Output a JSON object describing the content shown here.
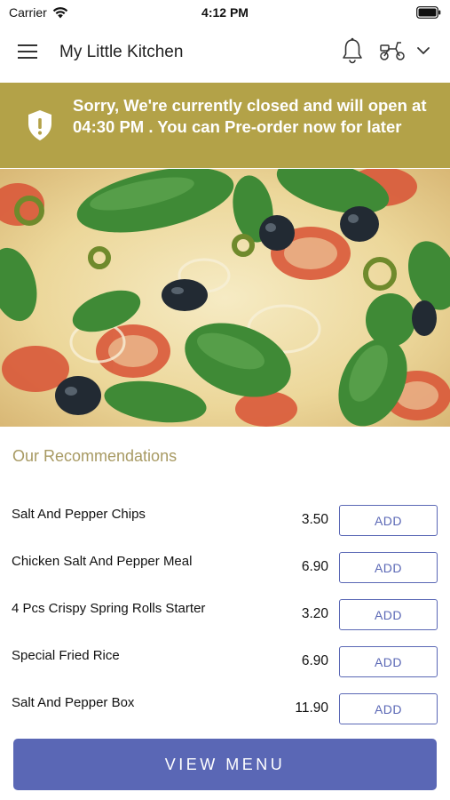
{
  "status_bar": {
    "carrier": "Carrier",
    "time": "4:12 PM"
  },
  "header": {
    "title": "My Little Kitchen",
    "icons": [
      "menu-icon",
      "bell-icon",
      "scooter-icon",
      "chevron-down-icon"
    ]
  },
  "banner": {
    "message": "Sorry, We're currently closed and will open at 04:30 PM . You can Pre-order now for later",
    "icon": "shield-exclamation-icon",
    "color": "#b3a248"
  },
  "recommendations": {
    "title": "Our Recommendations",
    "items": [
      {
        "name": "Salt And Pepper Chips",
        "price": "3.50",
        "button": "ADD"
      },
      {
        "name": "Chicken Salt And Pepper Meal",
        "price": "6.90",
        "button": "ADD"
      },
      {
        "name": "4 Pcs Crispy Spring Rolls Starter",
        "price": "3.20",
        "button": "ADD"
      },
      {
        "name": "Special Fried Rice",
        "price": "6.90",
        "button": "ADD"
      },
      {
        "name": "Salt And Pepper Box",
        "price": "11.90",
        "button": "ADD"
      }
    ]
  },
  "footer": {
    "view_menu_label": "VIEW MENU"
  },
  "colors": {
    "accent": "#5a67b5",
    "section_title": "#a89a63"
  }
}
